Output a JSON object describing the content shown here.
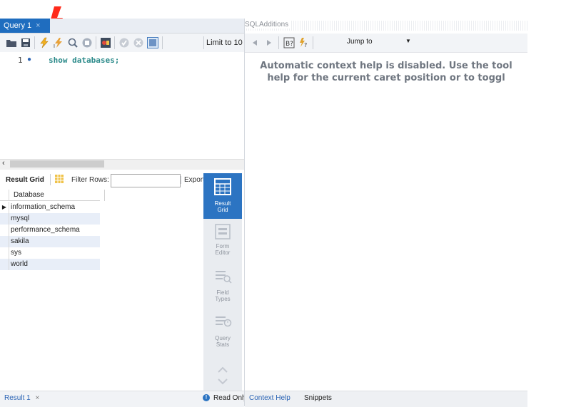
{
  "editor_tab": {
    "label": "Query 1",
    "close": "×"
  },
  "toolbar": {
    "icons": [
      "open-folder-icon",
      "save-icon",
      "execute-icon",
      "execute-current-icon",
      "explain-icon",
      "stop-icon",
      "toggle-result-icon",
      "commit-icon",
      "rollback-icon",
      "autocommit-icon"
    ],
    "limit_label": "Limit to 10"
  },
  "editor": {
    "line_number": "1",
    "code": "show databases;"
  },
  "result_toolbar": {
    "grid_label": "Result Grid",
    "filter_label": "Filter Rows:",
    "filter_value": "",
    "export_label": "Export"
  },
  "grid": {
    "header": "Database",
    "rows": [
      "information_schema",
      "mysql",
      "performance_schema",
      "sakila",
      "sys",
      "world"
    ]
  },
  "modes": [
    {
      "label": "Result\nGrid"
    },
    {
      "label": "Form\nEditor"
    },
    {
      "label": "Field\nTypes"
    },
    {
      "label": "Query\nStats"
    }
  ],
  "bottom_left": {
    "result_tab": "Result 1",
    "close": "×",
    "status": "Read Only"
  },
  "sql_additions": {
    "title": "SQLAdditions",
    "jump_label": "Jump to",
    "help_line1": "Automatic context help is disabled. Use the tool",
    "help_line2": "help for the current caret position or to toggl"
  },
  "bottom_right": {
    "tab1": "Context Help",
    "tab2": "Snippets"
  },
  "colors": {
    "accent": "#2c74c2",
    "annotation": "#ff2a1a"
  }
}
